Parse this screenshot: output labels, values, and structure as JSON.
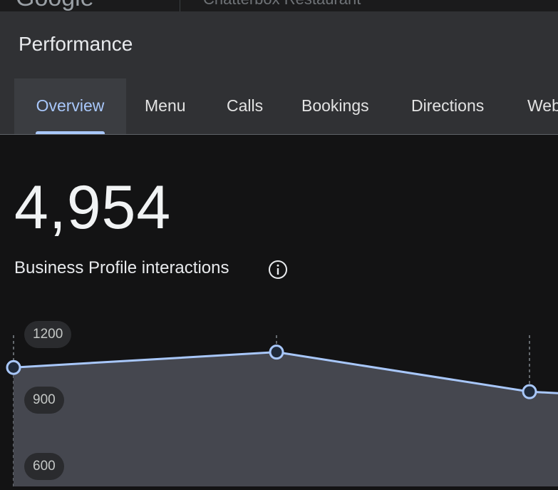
{
  "header": {
    "logo_text": "Google",
    "business_name": "Chatterbox Restaurant"
  },
  "panel": {
    "title": "Performance",
    "tabs": [
      {
        "label": "Overview",
        "active": true
      },
      {
        "label": "Menu",
        "active": false
      },
      {
        "label": "Calls",
        "active": false
      },
      {
        "label": "Bookings",
        "active": false
      },
      {
        "label": "Directions",
        "active": false
      },
      {
        "label": "Web",
        "active": false
      }
    ]
  },
  "metric": {
    "value": "4,954",
    "label": "Business Profile interactions",
    "info_icon": "info-icon"
  },
  "chart_data": {
    "type": "area",
    "y_ticks": [
      "1200",
      "900",
      "600"
    ],
    "ylim": [
      600,
      1200
    ],
    "series": [
      {
        "values": [
          1050,
          1120,
          940,
          920
        ]
      }
    ],
    "colors": {
      "line": "#a8c7fa",
      "fill": "#45474f",
      "accent": "#a8c7fa"
    }
  }
}
